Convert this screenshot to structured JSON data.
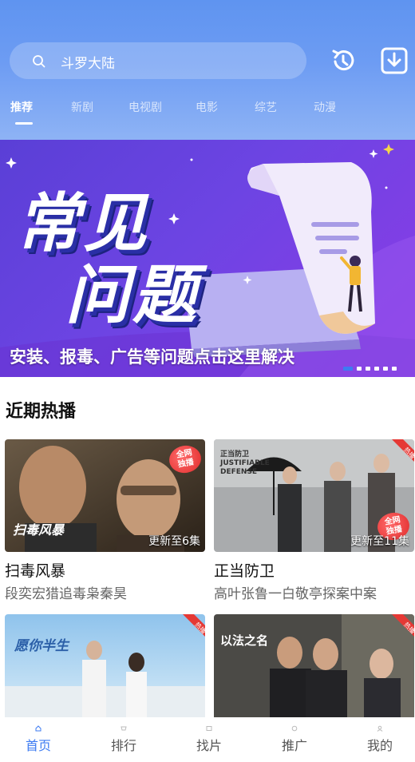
{
  "search": {
    "text": "斗罗大陆"
  },
  "tabs": [
    {
      "label": "推荐"
    },
    {
      "label": "新剧"
    },
    {
      "label": "电视剧"
    },
    {
      "label": "电影"
    },
    {
      "label": "综艺"
    },
    {
      "label": "动漫"
    }
  ],
  "banner": {
    "title_line1": "常见",
    "title_line2": "问题",
    "caption": "安装、报毒、广告等问题点击这里解决",
    "slide_count": 6,
    "active_slide": 1
  },
  "section": {
    "title": "近期热播"
  },
  "cards": [
    {
      "title": "扫毒风暴",
      "desc": "段奕宏猎追毒枭秦昊",
      "episodes": "更新至6集",
      "poster_text": "扫毒风暴",
      "badge": "全网\n独播"
    },
    {
      "title": "正当防卫",
      "desc": "高叶张鲁一白敬亭探案中案",
      "episodes": "更新至11集",
      "poster_text": "正当防卫 JUSTIFIABLE DEFENSE",
      "badge": "全网\n独播",
      "hot": "热播"
    },
    {
      "title": "",
      "desc": "",
      "poster_text": "愿你半生",
      "hot": "热播"
    },
    {
      "title": "",
      "desc": "",
      "poster_text": "以法之名",
      "hot": "热播"
    }
  ],
  "tabbar": [
    {
      "label": "首页",
      "active": true
    },
    {
      "label": "排行"
    },
    {
      "label": "找片"
    },
    {
      "label": "推广"
    },
    {
      "label": "我的"
    }
  ],
  "colors": {
    "accent": "#3d7bf2",
    "header": "#6d9cf3",
    "hot": "#e53935"
  }
}
